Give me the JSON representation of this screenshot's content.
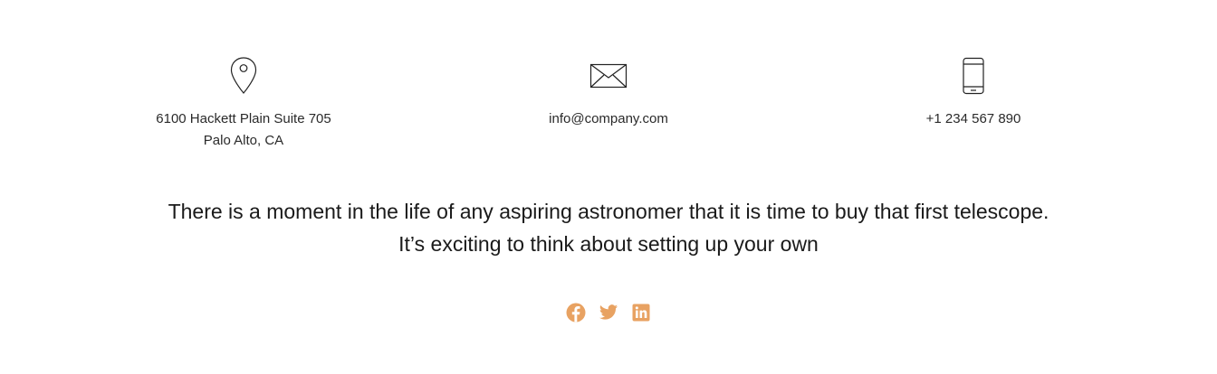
{
  "contact": {
    "address": {
      "icon": "map-pin-icon",
      "line1": "6100 Hackett Plain Suite 705",
      "line2": "Palo Alto, CA"
    },
    "email": {
      "icon": "envelope-icon",
      "value": "info@company.com"
    },
    "phone": {
      "icon": "mobile-phone-icon",
      "value": "+1 234 567 890"
    }
  },
  "tagline": {
    "line1": "There is a moment in the life of any aspiring astronomer that it is time to buy that first telescope.",
    "line2": "It’s exciting to think about setting up your own"
  },
  "social": {
    "accent_color": "#e8a262",
    "icons": [
      "facebook-icon",
      "twitter-icon",
      "linkedin-icon"
    ]
  }
}
